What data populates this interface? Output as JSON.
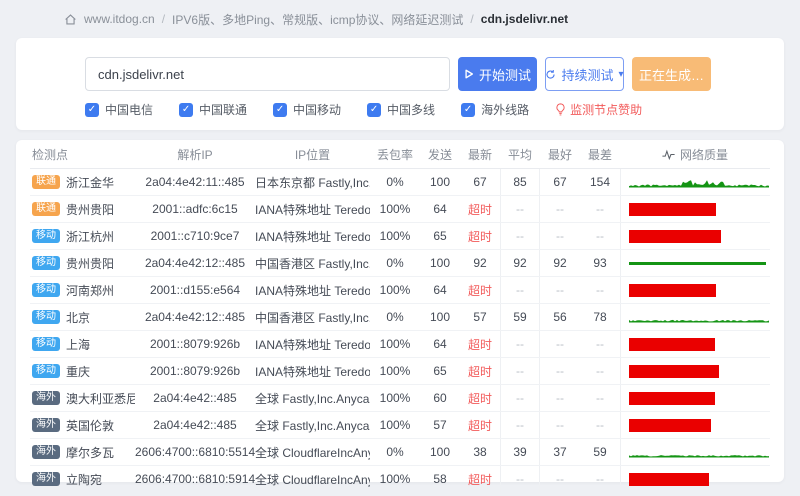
{
  "breadcrumb": {
    "home_label": "www.itdog.cn",
    "separator": "/",
    "path_label": "IPV6版、多地Ping、常规版、icmp协议、网络延迟测试",
    "target_label": "cdn.jsdelivr.net"
  },
  "toolbar": {
    "input_value": "cdn.jsdelivr.net",
    "start_label": "开始测试",
    "continuous_label": "持续测试",
    "caret": "▾",
    "generating_label": "正在生成…"
  },
  "filters": {
    "options": [
      {
        "label": "中国电信",
        "checked": true
      },
      {
        "label": "中国联通",
        "checked": true
      },
      {
        "label": "中国移动",
        "checked": true
      },
      {
        "label": "中国多线",
        "checked": true
      },
      {
        "label": "海外线路",
        "checked": true
      }
    ],
    "check_glyph": "✓",
    "sponsor_label": "监测节点赞助"
  },
  "table": {
    "headers": [
      "检测点",
      "解析IP",
      "IP位置",
      "丢包率",
      "发送",
      "最新",
      "平均",
      "最好",
      "最差",
      "网络质量"
    ],
    "timeout_text": "超时",
    "empty_text": "--",
    "rows": [
      {
        "carrier": "联通",
        "location": "浙江金华",
        "ip": "2a04:4e42:11::485",
        "ip_location": "日本东京都 Fastly,Inc.",
        "loss": "0%",
        "sent": "100",
        "latest": "67",
        "avg": "85",
        "best": "67",
        "worst": "154",
        "quality": {
          "type": "sparkline",
          "amp": 2,
          "burst": true
        }
      },
      {
        "carrier": "联通",
        "location": "贵州贵阳",
        "ip": "2001::adfc:6c15",
        "ip_location": "IANA特殊地址 Teredo隧道地址",
        "loss": "100%",
        "sent": "64",
        "latest": "超时",
        "avg": "--",
        "best": "--",
        "worst": "--",
        "quality": {
          "type": "bar",
          "width_pct": 62
        }
      },
      {
        "carrier": "移动",
        "location": "浙江杭州",
        "ip": "2001::c710:9ce7",
        "ip_location": "IANA特殊地址 Teredo隧道地址",
        "loss": "100%",
        "sent": "65",
        "latest": "超时",
        "avg": "--",
        "best": "--",
        "worst": "--",
        "quality": {
          "type": "bar",
          "width_pct": 65
        }
      },
      {
        "carrier": "移动",
        "location": "贵州贵阳",
        "ip": "2a04:4e42:12::485",
        "ip_location": "中国香港区 Fastly,Inc.",
        "loss": "0%",
        "sent": "100",
        "latest": "92",
        "avg": "92",
        "best": "92",
        "worst": "93",
        "quality": {
          "type": "line"
        }
      },
      {
        "carrier": "移动",
        "location": "河南郑州",
        "ip": "2001::d155:e564",
        "ip_location": "IANA特殊地址 Teredo隧道地址",
        "loss": "100%",
        "sent": "64",
        "latest": "超时",
        "avg": "--",
        "best": "--",
        "worst": "--",
        "quality": {
          "type": "bar",
          "width_pct": 62
        }
      },
      {
        "carrier": "移动",
        "location": "北京",
        "ip": "2a04:4e42:12::485",
        "ip_location": "中国香港区 Fastly,Inc.",
        "loss": "0%",
        "sent": "100",
        "latest": "57",
        "avg": "59",
        "best": "56",
        "worst": "78",
        "quality": {
          "type": "sparkline",
          "amp": 1.6,
          "burst": false
        }
      },
      {
        "carrier": "移动",
        "location": "上海",
        "ip": "2001::8079:926b",
        "ip_location": "IANA特殊地址 Teredo隧道地址",
        "loss": "100%",
        "sent": "64",
        "latest": "超时",
        "avg": "--",
        "best": "--",
        "worst": "--",
        "quality": {
          "type": "bar",
          "width_pct": 61
        }
      },
      {
        "carrier": "移动",
        "location": "重庆",
        "ip": "2001::8079:926b",
        "ip_location": "IANA特殊地址 Teredo隧道地址",
        "loss": "100%",
        "sent": "65",
        "latest": "超时",
        "avg": "--",
        "best": "--",
        "worst": "--",
        "quality": {
          "type": "bar",
          "width_pct": 64
        }
      },
      {
        "carrier": "海外",
        "location": "澳大利亚悉尼",
        "ip": "2a04:4e42::485",
        "ip_location": "全球 Fastly,Inc.Anycast网段",
        "loss": "100%",
        "sent": "60",
        "latest": "超时",
        "avg": "--",
        "best": "--",
        "worst": "--",
        "quality": {
          "type": "bar",
          "width_pct": 61
        }
      },
      {
        "carrier": "海外",
        "location": "英国伦敦",
        "ip": "2a04:4e42::485",
        "ip_location": "全球 Fastly,Inc.Anycast网段",
        "loss": "100%",
        "sent": "57",
        "latest": "超时",
        "avg": "--",
        "best": "--",
        "worst": "--",
        "quality": {
          "type": "bar",
          "width_pct": 58
        }
      },
      {
        "carrier": "海外",
        "location": "摩尔多瓦",
        "ip": "2606:4700::6810:5514",
        "ip_location": "全球 CloudflareIncAnycast网段",
        "loss": "0%",
        "sent": "100",
        "latest": "38",
        "avg": "39",
        "best": "37",
        "worst": "59",
        "quality": {
          "type": "sparkline",
          "amp": 1.4,
          "burst": false
        }
      },
      {
        "carrier": "海外",
        "location": "立陶宛",
        "ip": "2606:4700::6810:5914",
        "ip_location": "全球 CloudflareIncAnycast网段",
        "loss": "100%",
        "sent": "58",
        "latest": "超时",
        "avg": "--",
        "best": "--",
        "worst": "--",
        "quality": {
          "type": "bar",
          "width_pct": 57
        }
      }
    ]
  },
  "icons": {
    "home-icon": "house outline",
    "play-icon": "play triangle",
    "refresh-icon": "circular arrows",
    "caret-down-icon": "caret down",
    "check-icon": "checkmark",
    "sponsor-icon": "lightbulb",
    "activity-icon": "pulse waveform"
  },
  "colors": {
    "page_bg": "#eef0f4",
    "accent_blue": "#4a7bee",
    "generating_orange": "#f8bb76",
    "checkbox_blue": "#3e7bf0",
    "sponsor_red": "#f25b5b",
    "timeout_red": "#f25b5b",
    "quality_green": "#149414",
    "quality_red": "#ea0000",
    "carriers": {
      "联通": "#f6a44d",
      "移动": "#3fa7f0",
      "海外": "#5a6b80"
    }
  }
}
